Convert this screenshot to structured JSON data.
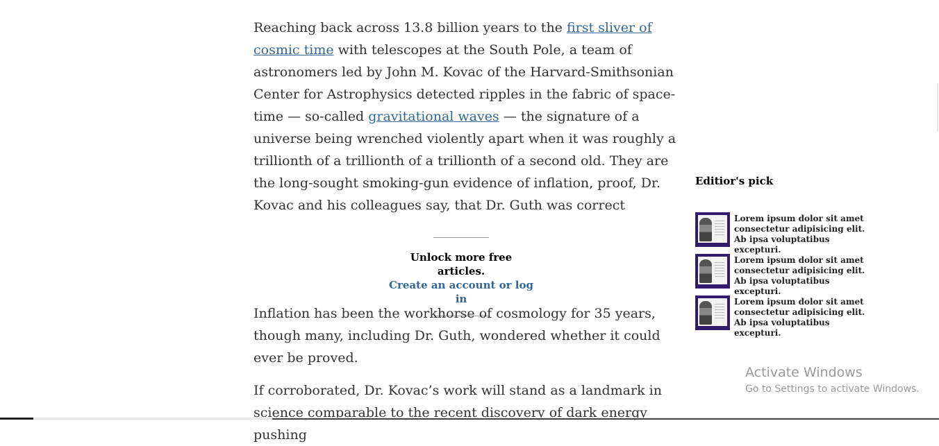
{
  "article": {
    "cutoff_text": "g",
    "paragraph1": {
      "part1": "Reaching back across 13.8 billion years to the ",
      "link1": "first sliver of cosmic time",
      "part2": " with telescopes at the South Pole, a team of astronomers led by John M. Kovac of the Harvard-Smithsonian Center for Astrophysics detected ripples in the fabric of space-time — so-called ",
      "link2": "gravitational waves",
      "part3": " — the signature of a universe being wrenched violently apart when it was roughly a trillionth of a trillionth of a trillionth of a second old. They are the long-sought smoking-gun evidence of inflation, proof, Dr. Kovac and his colleagues say, that Dr. Guth was correct"
    },
    "paragraph2": "Inflation has been the workhorse of cosmology for 35 years, though many, including Dr. Guth, wondered whether it could ever be proved.",
    "paragraph3": "If corroborated, Dr. Kovac’s work will stand as a landmark in science comparable to the recent discovery of dark energy pushing"
  },
  "promo": {
    "unlock": "Unlock more free articles.",
    "create": "Create an account or log in"
  },
  "sidebar": {
    "title": "Editior's pick",
    "items": [
      {
        "text": "Lorem ipsum dolor sit amet consectetur adipisicing elit. Ab ipsa voluptatibus excepturi."
      },
      {
        "text": "Lorem ipsum dolor sit amet consectetur adipisicing elit. Ab ipsa voluptatibus excepturi."
      },
      {
        "text": "Lorem ipsum dolor sit amet consectetur adipisicing elit. Ab ipsa voluptatibus excepturi."
      }
    ]
  },
  "watermark": {
    "title": "Activate Windows",
    "subtitle": "Go to Settings to activate Windows."
  },
  "colors": {
    "link": "#336699",
    "thumb_border": "#2e1b6b",
    "body_text": "#333333"
  }
}
